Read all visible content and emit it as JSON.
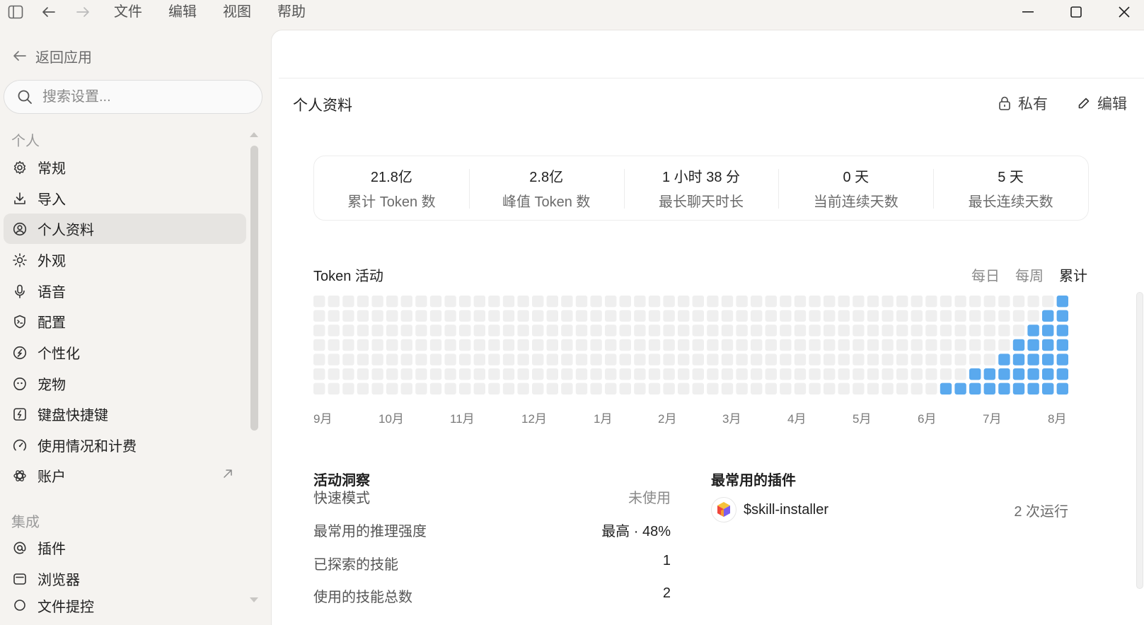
{
  "menu": [
    "文件",
    "编辑",
    "视图",
    "帮助"
  ],
  "sidebar": {
    "back_label": "返回应用",
    "search_placeholder": "搜索设置...",
    "section_personal": "个人",
    "personal_items": [
      {
        "label": "常规",
        "icon": "gear-icon"
      },
      {
        "label": "导入",
        "icon": "download-icon"
      },
      {
        "label": "个人资料",
        "icon": "user-circle-icon",
        "active": true
      },
      {
        "label": "外观",
        "icon": "sun-icon"
      },
      {
        "label": "语音",
        "icon": "microphone-icon"
      },
      {
        "label": "配置",
        "icon": "config-shield-icon"
      },
      {
        "label": "个性化",
        "icon": "personalize-icon"
      },
      {
        "label": "宠物",
        "icon": "pet-icon"
      },
      {
        "label": "键盘快捷键",
        "icon": "lightning-key-icon"
      },
      {
        "label": "使用情况和计费",
        "icon": "gauge-icon"
      },
      {
        "label": "账户",
        "icon": "openai-logo-icon",
        "external": true
      }
    ],
    "section_integrations": "集成",
    "integration_items": [
      {
        "label": "插件",
        "icon": "at-sign-icon"
      },
      {
        "label": "浏览器",
        "icon": "browser-window-icon"
      },
      {
        "label": "文件提控",
        "icon": "generic-icon"
      }
    ]
  },
  "profile": {
    "title": "个人资料",
    "private_label": "私有",
    "edit_label": "编辑"
  },
  "stats": [
    {
      "value": "21.8亿",
      "label": "累计 Token 数"
    },
    {
      "value": "2.8亿",
      "label": "峰值 Token 数"
    },
    {
      "value": "1 小时 38 分",
      "label": "最长聊天时长"
    },
    {
      "value": "0 天",
      "label": "当前连续天数"
    },
    {
      "value": "5 天",
      "label": "最长连续天数"
    }
  ],
  "activity": {
    "title": "Token 活动",
    "tabs": [
      "每日",
      "每周",
      "累计"
    ],
    "selected_tab": "累计",
    "months": [
      "9月",
      "10月",
      "11月",
      "12月",
      "1月",
      "2月",
      "3月",
      "4月",
      "5月",
      "6月",
      "7月",
      "8月"
    ],
    "weeks": 52,
    "rows": 7,
    "active_levels": [
      0,
      0,
      0,
      0,
      0,
      0,
      0,
      0,
      0,
      0,
      0,
      0,
      0,
      0,
      0,
      0,
      0,
      0,
      0,
      0,
      0,
      0,
      0,
      0,
      0,
      0,
      0,
      0,
      0,
      0,
      0,
      0,
      0,
      0,
      0,
      0,
      0,
      0,
      0,
      0,
      0,
      0,
      0,
      1,
      1,
      2,
      2,
      3,
      4,
      5,
      6,
      7
    ],
    "empty_color": "#efefef",
    "active_color": "#5aa9ee"
  },
  "insights": {
    "title": "活动洞察",
    "rows": [
      {
        "label": "快速模式",
        "value": "未使用",
        "muted": true
      },
      {
        "label": "最常用的推理强度",
        "value": "最高 · 48%"
      },
      {
        "label": "已探索的技能",
        "value": "1"
      },
      {
        "label": "使用的技能总数",
        "value": "2"
      }
    ]
  },
  "plugins": {
    "title": "最常用的插件",
    "items": [
      {
        "name": "$skill-installer",
        "runs": "2 次运行",
        "icon": "cube-logo-icon"
      }
    ]
  }
}
